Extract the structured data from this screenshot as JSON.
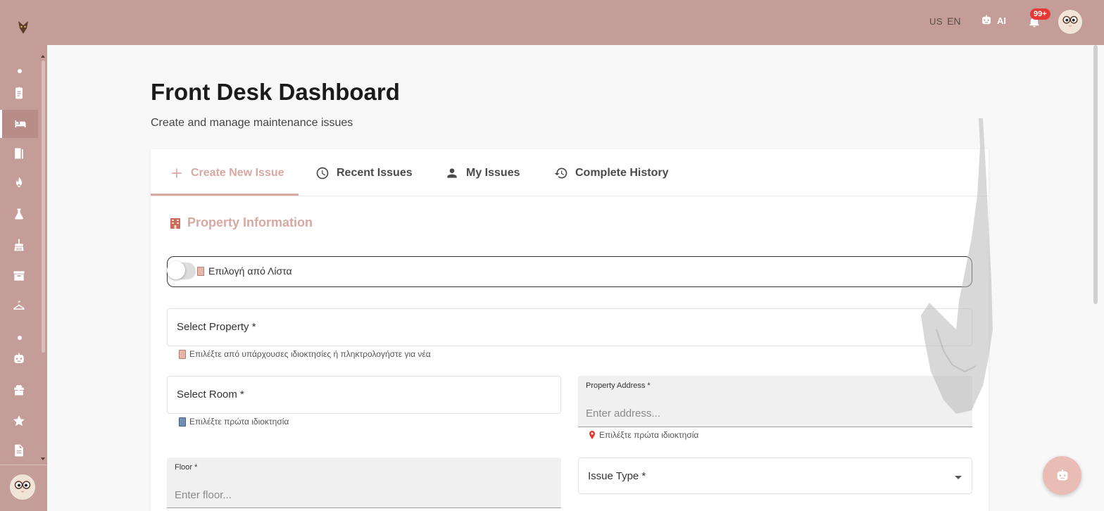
{
  "sidebar": {
    "nav": [
      {
        "name": "clipboard-icon"
      },
      {
        "name": "bed-icon"
      },
      {
        "name": "door-icon"
      },
      {
        "name": "fire-icon"
      },
      {
        "name": "flask-icon"
      },
      {
        "name": "broom-icon"
      },
      {
        "name": "archive-icon"
      },
      {
        "name": "hanger-icon"
      },
      {
        "name": "robot-icon"
      },
      {
        "name": "gift-icon"
      },
      {
        "name": "star-icon"
      },
      {
        "name": "document-icon"
      }
    ]
  },
  "header": {
    "lang_flag": "US",
    "lang_code": "EN",
    "ai_label": "AI",
    "notification_count": "99+"
  },
  "page": {
    "title": "Front Desk Dashboard",
    "subtitle": "Create and manage maintenance issues"
  },
  "tabs": [
    {
      "label": "Create New Issue",
      "icon": "plus-icon",
      "active": true
    },
    {
      "label": "Recent Issues",
      "icon": "clock-icon"
    },
    {
      "label": "My Issues",
      "icon": "person-icon"
    },
    {
      "label": "Complete History",
      "icon": "history-icon"
    }
  ],
  "form": {
    "section_title": "Property Information",
    "toggle_label": "Επιλογή από Λίστα",
    "select_property": {
      "label": "Select Property *",
      "helper": "Επιλέξτε από υπάρχουσες ιδιοκτησίες ή πληκτρολογήστε για νέα"
    },
    "select_room": {
      "label": "Select Room *",
      "helper": "Επιλέξτε πρώτα ιδιοκτησία"
    },
    "property_address": {
      "label": "Property Address *",
      "placeholder": "Enter address...",
      "helper": "Επιλέξτε πρώτα ιδιοκτησία"
    },
    "floor": {
      "label": "Floor *",
      "placeholder": "Enter floor..."
    },
    "issue_type": {
      "label": "Issue Type *"
    }
  },
  "colors": {
    "brand": "#c49d98",
    "accent": "#d8a8a2",
    "badge": "#e53935"
  }
}
